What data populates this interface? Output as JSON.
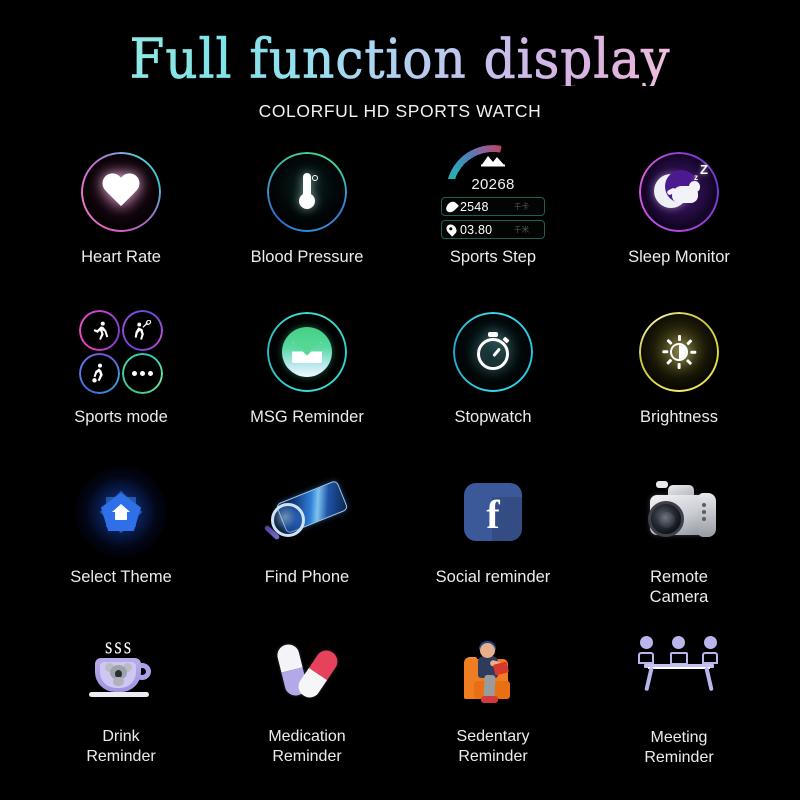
{
  "header": {
    "title": "Full function display",
    "subtitle": "COLORFUL HD SPORTS WATCH",
    "title_gradient_start": "#8fe9e6",
    "title_gradient_end": "#efc3e0"
  },
  "background_color": "#000000",
  "label_color": "#ececec",
  "features": [
    {
      "id": "heart-rate",
      "label": "Heart Rate",
      "icon": "heart-icon",
      "ring_colors": [
        "#e862c0",
        "#5fc8d8"
      ]
    },
    {
      "id": "blood-pressure",
      "label": "Blood Pressure",
      "icon": "thermometer-icon",
      "ring_colors": [
        "#43cf8e",
        "#2f6fd0"
      ]
    },
    {
      "id": "sports-step",
      "label": "Sports Step",
      "icon": "step-gauge-icon",
      "ring_colors": [
        "#1fb89e",
        "#b9455f"
      ]
    },
    {
      "id": "sleep-monitor",
      "label": "Sleep Monitor",
      "icon": "moon-cat-icon",
      "ring_colors": [
        "#a23de0",
        "#6c3ad2"
      ]
    },
    {
      "id": "sports-mode",
      "label": "Sports mode",
      "icon": "sports-quad-icon",
      "ring_colors": [
        "#e13fc0",
        "#3fc98a"
      ]
    },
    {
      "id": "msg-reminder",
      "label": "MSG Reminder",
      "icon": "envelope-icon",
      "ring_colors": [
        "#2fd4d0",
        "#40e0cf"
      ]
    },
    {
      "id": "stopwatch",
      "label": "Stopwatch",
      "icon": "stopwatch-icon",
      "ring_colors": [
        "#25c6e2",
        "#3fd9ee"
      ]
    },
    {
      "id": "brightness",
      "label": "Brightness",
      "icon": "sun-icon",
      "ring_colors": [
        "#e9e04a",
        "#f6f0a0"
      ]
    },
    {
      "id": "select-theme",
      "label": "Select Theme",
      "icon": "home-star-icon",
      "ring_colors": [
        "#2f6fe8",
        "#0a1c3c"
      ]
    },
    {
      "id": "find-phone",
      "label": "Find Phone",
      "icon": "phone-magnifier-icon",
      "ring_colors": [
        "#2f7fd8",
        "#7a6fd0"
      ]
    },
    {
      "id": "social-reminder",
      "label": "Social reminder",
      "icon": "facebook-icon",
      "ring_colors": [
        "#3b5998",
        "#3b5998"
      ]
    },
    {
      "id": "remote-camera",
      "label": "Remote\nCamera",
      "icon": "camera-icon",
      "ring_colors": [
        "#f4f4f6",
        "#2a2d35"
      ]
    },
    {
      "id": "drink-reminder",
      "label": "Drink\nReminder",
      "icon": "teacup-koala-icon",
      "ring_colors": [
        "#b9aeea",
        "#cfc7f2"
      ]
    },
    {
      "id": "medication-reminder",
      "label": "Medication\nReminder",
      "icon": "pills-icon",
      "ring_colors": [
        "#b3a8e8",
        "#e8415c"
      ]
    },
    {
      "id": "sedentary-reminder",
      "label": "Sedentary\nReminder",
      "icon": "person-armchair-icon",
      "ring_colors": [
        "#ef7d22",
        "#2e3b5c"
      ]
    },
    {
      "id": "meeting-reminder",
      "label": "Meeting\nReminder",
      "icon": "meeting-table-icon",
      "ring_colors": [
        "#b8b6ec",
        "#c3c1f0"
      ]
    }
  ],
  "sports_step_widget": {
    "steps_value": "20268",
    "calories_value": "2548",
    "calories_unit": "千卡",
    "distance_value": "03.80",
    "distance_unit": "千米",
    "gauge_start_color": "#1fb89e",
    "gauge_end_color": "#b9455f"
  },
  "facebook_icon": {
    "glyph": "f",
    "background": "#3b5998"
  },
  "sleep_icon": {
    "z_large": "Z",
    "z_small": "z"
  },
  "drink_icon": {
    "steam": "sss"
  }
}
